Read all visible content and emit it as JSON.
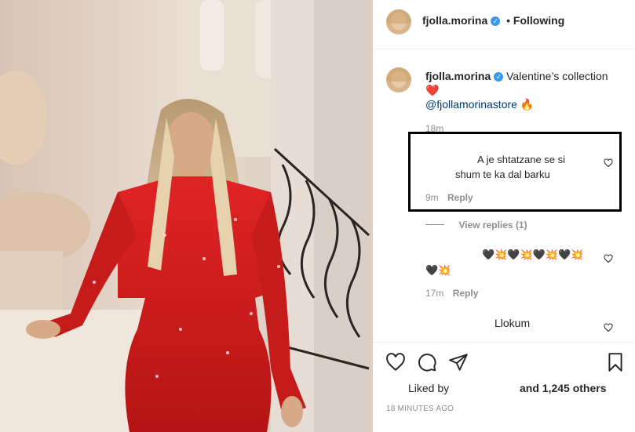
{
  "header": {
    "username": "fjolla.morina",
    "separator": "•",
    "follow_status": "Following"
  },
  "caption": {
    "username": "fjolla.morina",
    "text": "Valentine’s collection",
    "heart_emoji": "❤️",
    "mention": "@fjollamorinastore",
    "fire_emoji": "🔥",
    "time": "18m"
  },
  "comments": [
    {
      "text_line1": "A je shtatzane se si",
      "text_line2": "shum te ka dal barku",
      "time": "9m",
      "reply_label": "Reply"
    },
    {
      "view_replies": "View replies (1)"
    },
    {
      "text_line1": "🖤💥🖤💥🖤💥🖤💥",
      "text_line2": "🖤💥",
      "time": "17m",
      "reply_label": "Reply"
    },
    {
      "text_line1": "Llokum"
    }
  ],
  "actions": {
    "like_icon": "heart-icon",
    "comment_icon": "comment-icon",
    "share_icon": "paper-plane-icon",
    "save_icon": "bookmark-icon"
  },
  "likes": {
    "prefix": "Liked by",
    "suffix": "and 1,245 others"
  },
  "timestamp": "18 MINUTES AGO",
  "colors": {
    "verified": "#3897f0",
    "dress": "#d41d1d",
    "muted": "#8e8e8e"
  }
}
